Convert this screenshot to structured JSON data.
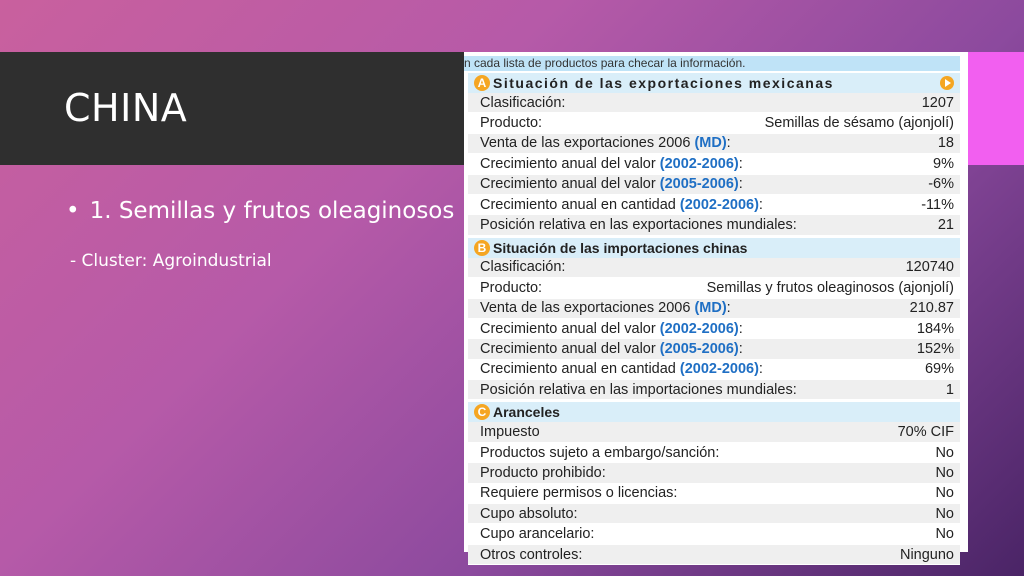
{
  "slide": {
    "title": "CHINA",
    "bullet": "1. Semillas y frutos oleaginosos",
    "sub": "- Cluster: Agroindustrial"
  },
  "panel": {
    "hint": "n cada lista de productos para checar la información.",
    "sections": [
      {
        "badge": "A",
        "title": "Situación de las exportaciones mexicanas",
        "rows": [
          {
            "label": "Clasificación:",
            "hl": "",
            "suffix": "",
            "value": "1207"
          },
          {
            "label": "Producto:",
            "hl": "",
            "suffix": "",
            "value": "Semillas de sésamo (ajonjolí)"
          },
          {
            "label": "Venta de las exportaciones 2006 ",
            "hl": "(MD)",
            "suffix": ":",
            "value": "18"
          },
          {
            "label": "Crecimiento anual del valor ",
            "hl": "(2002-2006)",
            "suffix": ":",
            "value": "9%"
          },
          {
            "label": "Crecimiento anual del valor ",
            "hl": "(2005-2006)",
            "suffix": ":",
            "value": "-6%"
          },
          {
            "label": "Crecimiento anual en cantidad ",
            "hl": "(2002-2006)",
            "suffix": ":",
            "value": "-11%"
          },
          {
            "label": "Posición relativa en las exportaciones mundiales:",
            "hl": "",
            "suffix": "",
            "value": "21"
          }
        ]
      },
      {
        "badge": "B",
        "title": "Situación de las importaciones chinas",
        "rows": [
          {
            "label": "Clasificación:",
            "hl": "",
            "suffix": "",
            "value": "120740"
          },
          {
            "label": "Producto:",
            "hl": "",
            "suffix": "",
            "value": "Semillas y frutos oleaginosos (ajonjolí)"
          },
          {
            "label": "Venta de las exportaciones 2006 ",
            "hl": "(MD)",
            "suffix": ":",
            "value": "210.87"
          },
          {
            "label": "Crecimiento anual del valor ",
            "hl": "(2002-2006)",
            "suffix": ":",
            "value": "184%"
          },
          {
            "label": "Crecimiento anual del valor ",
            "hl": "(2005-2006)",
            "suffix": ":",
            "value": "152%"
          },
          {
            "label": "Crecimiento anual en cantidad ",
            "hl": "(2002-2006)",
            "suffix": ":",
            "value": "69%"
          },
          {
            "label": "Posición relativa en las importaciones mundiales:",
            "hl": "",
            "suffix": "",
            "value": "1"
          }
        ]
      },
      {
        "badge": "C",
        "title": "Aranceles",
        "rows": [
          {
            "label": "Impuesto",
            "hl": "",
            "suffix": "",
            "value": "70% CIF"
          },
          {
            "label": "Productos sujeto a embargo/sanción:",
            "hl": "",
            "suffix": "",
            "value": "No"
          },
          {
            "label": "Producto prohibido:",
            "hl": "",
            "suffix": "",
            "value": "No"
          },
          {
            "label": "Requiere permisos o licencias:",
            "hl": "",
            "suffix": "",
            "value": "No"
          },
          {
            "label": "Cupo absoluto:",
            "hl": "",
            "suffix": "",
            "value": "No"
          },
          {
            "label": "Cupo arancelario:",
            "hl": "",
            "suffix": "",
            "value": "No"
          },
          {
            "label": "Otros controles:",
            "hl": "",
            "suffix": "",
            "value": "Ninguno"
          }
        ]
      }
    ]
  },
  "colors": {
    "accent": "#f5a623",
    "highlight": "#1f6fc4",
    "title_bar": "#2f2f2f",
    "pink": "#f25ff0"
  }
}
